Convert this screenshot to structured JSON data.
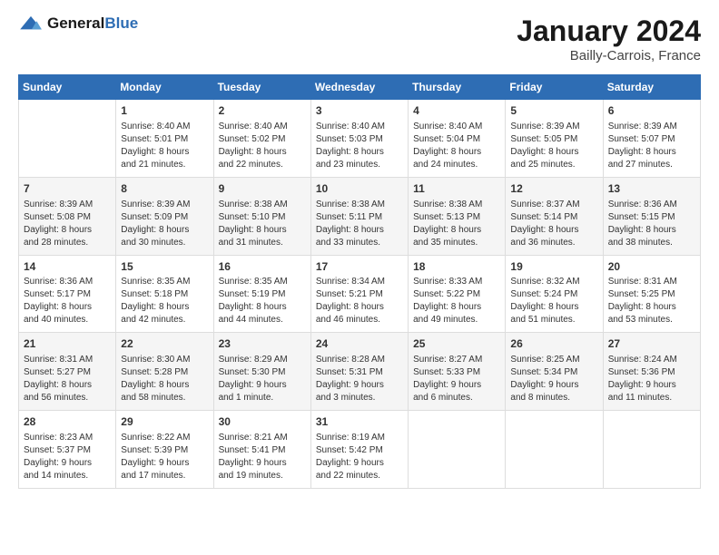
{
  "logo": {
    "general": "General",
    "blue": "Blue"
  },
  "title": {
    "month": "January 2024",
    "location": "Bailly-Carrois, France"
  },
  "weekdays": [
    "Sunday",
    "Monday",
    "Tuesday",
    "Wednesday",
    "Thursday",
    "Friday",
    "Saturday"
  ],
  "weeks": [
    [
      {
        "day": "",
        "info": ""
      },
      {
        "day": "1",
        "info": "Sunrise: 8:40 AM\nSunset: 5:01 PM\nDaylight: 8 hours\nand 21 minutes."
      },
      {
        "day": "2",
        "info": "Sunrise: 8:40 AM\nSunset: 5:02 PM\nDaylight: 8 hours\nand 22 minutes."
      },
      {
        "day": "3",
        "info": "Sunrise: 8:40 AM\nSunset: 5:03 PM\nDaylight: 8 hours\nand 23 minutes."
      },
      {
        "day": "4",
        "info": "Sunrise: 8:40 AM\nSunset: 5:04 PM\nDaylight: 8 hours\nand 24 minutes."
      },
      {
        "day": "5",
        "info": "Sunrise: 8:39 AM\nSunset: 5:05 PM\nDaylight: 8 hours\nand 25 minutes."
      },
      {
        "day": "6",
        "info": "Sunrise: 8:39 AM\nSunset: 5:07 PM\nDaylight: 8 hours\nand 27 minutes."
      }
    ],
    [
      {
        "day": "7",
        "info": ""
      },
      {
        "day": "8",
        "info": "Sunrise: 8:39 AM\nSunset: 5:09 PM\nDaylight: 8 hours\nand 30 minutes."
      },
      {
        "day": "9",
        "info": "Sunrise: 8:38 AM\nSunset: 5:10 PM\nDaylight: 8 hours\nand 31 minutes."
      },
      {
        "day": "10",
        "info": "Sunrise: 8:38 AM\nSunset: 5:11 PM\nDaylight: 8 hours\nand 33 minutes."
      },
      {
        "day": "11",
        "info": "Sunrise: 8:38 AM\nSunset: 5:13 PM\nDaylight: 8 hours\nand 35 minutes."
      },
      {
        "day": "12",
        "info": "Sunrise: 8:37 AM\nSunset: 5:14 PM\nDaylight: 8 hours\nand 36 minutes."
      },
      {
        "day": "13",
        "info": "Sunrise: 8:36 AM\nSunset: 5:15 PM\nDaylight: 8 hours\nand 38 minutes."
      }
    ],
    [
      {
        "day": "14",
        "info": ""
      },
      {
        "day": "15",
        "info": "Sunrise: 8:35 AM\nSunset: 5:18 PM\nDaylight: 8 hours\nand 42 minutes."
      },
      {
        "day": "16",
        "info": "Sunrise: 8:35 AM\nSunset: 5:19 PM\nDaylight: 8 hours\nand 44 minutes."
      },
      {
        "day": "17",
        "info": "Sunrise: 8:34 AM\nSunset: 5:21 PM\nDaylight: 8 hours\nand 46 minutes."
      },
      {
        "day": "18",
        "info": "Sunrise: 8:33 AM\nSunset: 5:22 PM\nDaylight: 8 hours\nand 49 minutes."
      },
      {
        "day": "19",
        "info": "Sunrise: 8:32 AM\nSunset: 5:24 PM\nDaylight: 8 hours\nand 51 minutes."
      },
      {
        "day": "20",
        "info": "Sunrise: 8:31 AM\nSunset: 5:25 PM\nDaylight: 8 hours\nand 53 minutes."
      }
    ],
    [
      {
        "day": "21",
        "info": ""
      },
      {
        "day": "22",
        "info": "Sunrise: 8:30 AM\nSunset: 5:28 PM\nDaylight: 8 hours\nand 58 minutes."
      },
      {
        "day": "23",
        "info": "Sunrise: 8:29 AM\nSunset: 5:30 PM\nDaylight: 9 hours\nand 1 minute."
      },
      {
        "day": "24",
        "info": "Sunrise: 8:28 AM\nSunset: 5:31 PM\nDaylight: 9 hours\nand 3 minutes."
      },
      {
        "day": "25",
        "info": "Sunrise: 8:27 AM\nSunset: 5:33 PM\nDaylight: 9 hours\nand 6 minutes."
      },
      {
        "day": "26",
        "info": "Sunrise: 8:25 AM\nSunset: 5:34 PM\nDaylight: 9 hours\nand 8 minutes."
      },
      {
        "day": "27",
        "info": "Sunrise: 8:24 AM\nSunset: 5:36 PM\nDaylight: 9 hours\nand 11 minutes."
      }
    ],
    [
      {
        "day": "28",
        "info": ""
      },
      {
        "day": "29",
        "info": "Sunrise: 8:22 AM\nSunset: 5:39 PM\nDaylight: 9 hours\nand 17 minutes."
      },
      {
        "day": "30",
        "info": "Sunrise: 8:21 AM\nSunset: 5:41 PM\nDaylight: 9 hours\nand 19 minutes."
      },
      {
        "day": "31",
        "info": "Sunrise: 8:19 AM\nSunset: 5:42 PM\nDaylight: 9 hours\nand 22 minutes."
      },
      {
        "day": "",
        "info": ""
      },
      {
        "day": "",
        "info": ""
      },
      {
        "day": "",
        "info": ""
      }
    ]
  ],
  "week1_sunday": "Sunrise: 8:39 AM\nSunset: 5:08 PM\nDaylight: 8 hours\nand 28 minutes.",
  "week2_sunday": "Sunrise: 8:36 AM\nSunset: 5:17 PM\nDaylight: 8 hours\nand 40 minutes.",
  "week3_sunday": "Sunrise: 8:31 AM\nSunset: 5:27 PM\nDaylight: 8 hours\nand 56 minutes.",
  "week4_sunday": "Sunrise: 8:23 AM\nSunset: 5:37 PM\nDaylight: 9 hours\nand 14 minutes."
}
